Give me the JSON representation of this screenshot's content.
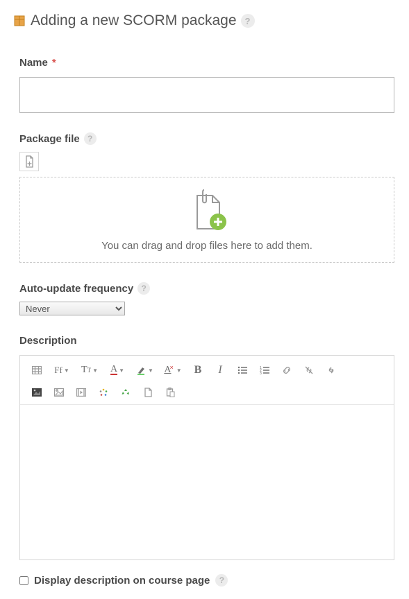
{
  "header": {
    "title": "Adding a new SCORM package"
  },
  "name": {
    "label": "Name",
    "required_marker": "*",
    "value": ""
  },
  "package_file": {
    "label": "Package file",
    "drop_text": "You can drag and drop files here to add them."
  },
  "auto_update": {
    "label": "Auto-update frequency",
    "selected": "Never"
  },
  "description": {
    "label": "Description",
    "value": ""
  },
  "display_description": {
    "label": "Display description on course page",
    "checked": false
  },
  "editor_toolbar": {
    "font_family": "Ff",
    "font_size": "T",
    "font_color": "A",
    "highlight_sym": "✔",
    "clear_format": "A",
    "bold": "B",
    "italic": "I"
  }
}
